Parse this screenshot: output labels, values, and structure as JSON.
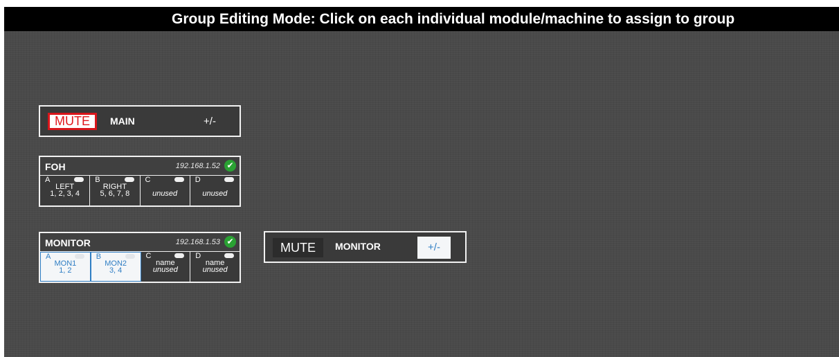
{
  "header": {
    "title": "Group Editing Mode: Click on each individual module/machine to assign to group"
  },
  "groups": [
    {
      "mute_label": "MUTE",
      "name": "MAIN",
      "trim_label": "+/-"
    },
    {
      "mute_label": "MUTE",
      "name": "MONITOR",
      "trim_label": "+/-"
    }
  ],
  "machines": [
    {
      "name": "FOH",
      "ip": "192.168.1.52",
      "status_icon": "checkmark-icon",
      "modules": [
        {
          "letter": "A",
          "line1": "LEFT",
          "line2": "1, 2, 3, 4"
        },
        {
          "letter": "B",
          "line1": "RIGHT",
          "line2": "5, 6, 7, 8"
        },
        {
          "letter": "C",
          "line1": "",
          "line2": "unused"
        },
        {
          "letter": "D",
          "line1": "",
          "line2": "unused"
        }
      ]
    },
    {
      "name": "MONITOR",
      "ip": "192.168.1.53",
      "status_icon": "checkmark-icon",
      "modules": [
        {
          "letter": "A",
          "line1": "MON1",
          "line2": "1, 2"
        },
        {
          "letter": "B",
          "line1": "MON2",
          "line2": "3, 4"
        },
        {
          "letter": "C",
          "line1": "name",
          "line2": "unused"
        },
        {
          "letter": "D",
          "line1": "name",
          "line2": "unused"
        }
      ]
    }
  ],
  "colors": {
    "mute_active": "#e0161b",
    "selected": "#2f7ec4",
    "status_ok": "#2aa233"
  }
}
